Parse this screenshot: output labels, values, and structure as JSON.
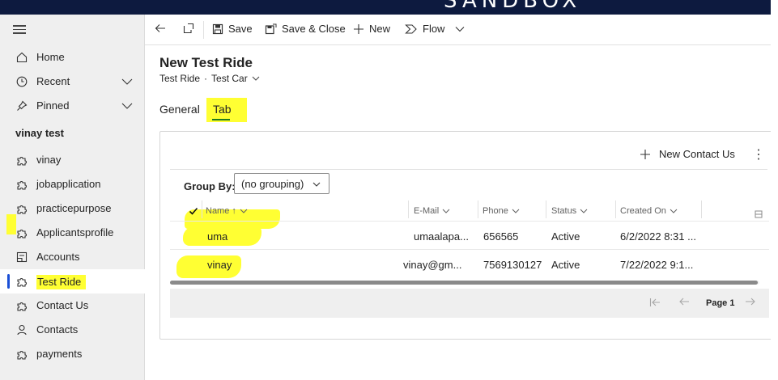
{
  "top_banner": "SANDBOX",
  "sidebar": {
    "nav": [
      {
        "label": "Home",
        "icon": "home-icon"
      },
      {
        "label": "Recent",
        "icon": "clock-icon"
      },
      {
        "label": "Pinned",
        "icon": "pin-icon"
      }
    ],
    "section_title": "vinay test",
    "items": [
      {
        "label": "vinay",
        "icon": "puzzle-icon"
      },
      {
        "label": "jobapplication",
        "icon": "puzzle-icon"
      },
      {
        "label": "practicepurpose",
        "icon": "puzzle-icon"
      },
      {
        "label": "Applicantsprofile",
        "icon": "puzzle-icon"
      },
      {
        "label": "Accounts",
        "icon": "accounts-icon"
      },
      {
        "label": "Test Ride",
        "icon": "puzzle-icon",
        "active": true
      },
      {
        "label": "Contact Us",
        "icon": "puzzle-icon"
      },
      {
        "label": "Contacts",
        "icon": "person-icon"
      },
      {
        "label": "payments",
        "icon": "puzzle-icon"
      }
    ]
  },
  "toolbar": {
    "save": "Save",
    "save_close": "Save & Close",
    "new": "New",
    "flow": "Flow"
  },
  "form": {
    "title": "New Test Ride",
    "entity": "Test Ride",
    "separator": "·",
    "form_name": "Test Car"
  },
  "tabs": [
    "General",
    "Tab"
  ],
  "subgrid": {
    "new_button": "New Contact Us",
    "group_by_label": "Group By:",
    "group_by_value": "(no grouping)",
    "columns": {
      "name": "Name ↑",
      "email": "E-Mail",
      "phone": "Phone",
      "status": "Status",
      "created_on": "Created On"
    },
    "rows": [
      {
        "name": "uma",
        "email": "umaalapa...",
        "phone": "656565",
        "status": "Active",
        "created_on": "6/2/2022 8:31 ..."
      },
      {
        "name": "vinay",
        "email": "vinay@gm...",
        "phone": "7569130127",
        "status": "Active",
        "created_on": "7/22/2022 9:1..."
      }
    ],
    "page_label": "Page 1"
  },
  "colors": {
    "highlight": "#ffff33",
    "active_indicator": "#1a4fd6",
    "tab_underline": "#1f7a1f",
    "banner_bg": "#0d1a3f"
  }
}
